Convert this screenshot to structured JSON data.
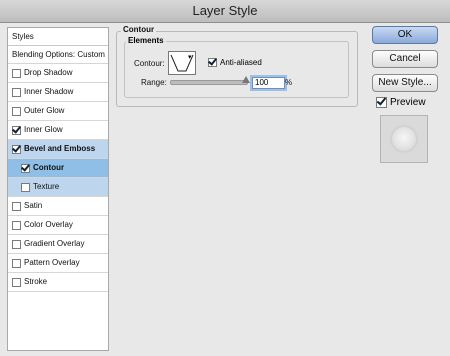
{
  "window": {
    "title": "Layer Style"
  },
  "styles": {
    "header": "Styles",
    "blending_options": "Blending Options: Custom",
    "items": [
      {
        "label": "Drop Shadow",
        "checked": false
      },
      {
        "label": "Inner Shadow",
        "checked": false
      },
      {
        "label": "Outer Glow",
        "checked": false
      },
      {
        "label": "Inner Glow",
        "checked": true
      },
      {
        "label": "Bevel and Emboss",
        "checked": true
      },
      {
        "label": "Contour",
        "checked": true
      },
      {
        "label": "Texture",
        "checked": false
      },
      {
        "label": "Satin",
        "checked": false
      },
      {
        "label": "Color Overlay",
        "checked": false
      },
      {
        "label": "Gradient Overlay",
        "checked": false
      },
      {
        "label": "Pattern Overlay",
        "checked": false
      },
      {
        "label": "Stroke",
        "checked": false
      }
    ]
  },
  "contour": {
    "group_title": "Contour",
    "elements_title": "Elements",
    "contour_label": "Contour:",
    "anti_aliased_label": "Anti-aliased",
    "anti_aliased_checked": true,
    "range_label": "Range:",
    "range_value": "100",
    "range_unit": "%",
    "range_level": 100
  },
  "buttons": {
    "ok": "OK",
    "cancel": "Cancel",
    "new_style": "New Style..."
  },
  "preview": {
    "label": "Preview",
    "checked": true
  }
}
